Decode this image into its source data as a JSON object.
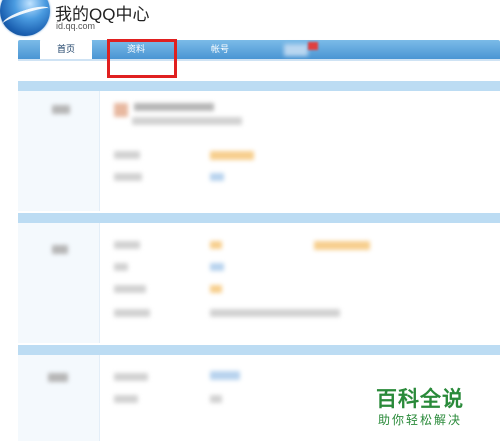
{
  "header": {
    "title": "我的QQ中心",
    "subtitle": "id.qq.com"
  },
  "nav": {
    "tabs": [
      {
        "label": "首页",
        "active": true
      },
      {
        "label": "资料",
        "active": false
      },
      {
        "label": "帐号",
        "active": false
      }
    ]
  },
  "watermark": {
    "title": "百科全说",
    "subtitle": "助你轻松解决"
  },
  "colors": {
    "nav_blue": "#4a95d3",
    "highlight_red": "#e02020",
    "section_bar": "#bcdcf3",
    "watermark_green": "#2a8a3a"
  },
  "icons": [
    "qq-globe-logo-icon"
  ]
}
